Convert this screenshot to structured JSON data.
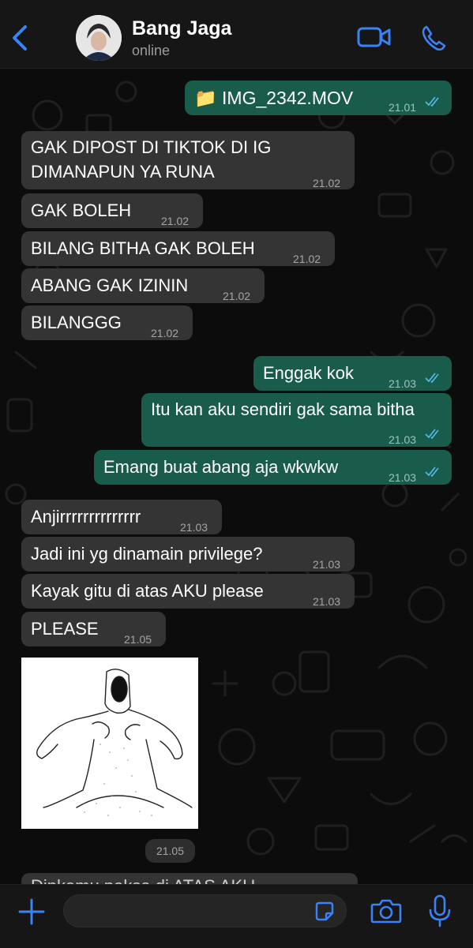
{
  "header": {
    "contact_name": "Bang Jaga",
    "status": "online"
  },
  "messages": [
    {
      "dir": "out",
      "text": "📁 IMG_2342.MOV",
      "time": "21.01",
      "read": true
    },
    {
      "dir": "in",
      "lines": [
        "GAK DIPOST DI TIKTOK DI IG",
        "DIMANAPUN YA RUNA"
      ],
      "time": "21.02"
    },
    {
      "dir": "in",
      "text": "GAK BOLEH",
      "time": "21.02"
    },
    {
      "dir": "in",
      "text": "BILANG BITHA GAK BOLEH",
      "time": "21.02"
    },
    {
      "dir": "in",
      "text": "ABANG GAK IZININ",
      "time": "21.02"
    },
    {
      "dir": "in",
      "text": "BILANGGG",
      "time": "21.02"
    },
    {
      "dir": "out",
      "text": "Enggak kok",
      "time": "21.03",
      "read": true
    },
    {
      "dir": "out",
      "text": "Itu kan aku sendiri gak sama bitha",
      "time": "21.03",
      "read": true
    },
    {
      "dir": "out",
      "text": "Emang buat abang aja wkwkw",
      "time": "21.03",
      "read": true
    },
    {
      "dir": "in",
      "text": "Anjirrrrrrrrrrrrrr",
      "time": "21.03"
    },
    {
      "dir": "in",
      "text": "Jadi ini yg dinamain privilege?",
      "time": "21.03"
    },
    {
      "dir": "in",
      "text": "Kayak gitu di atas AKU please",
      "time": "21.03"
    },
    {
      "dir": "in",
      "text": "PLEASE",
      "time": "21.05"
    }
  ],
  "image_message": {
    "time": "21.05"
  },
  "partial_message": {
    "text": "Dipkamu paksa di ATAS AKU"
  },
  "colors": {
    "outgoing_bubble": "#1a5c4c",
    "incoming_bubble": "#343434",
    "accent": "#3b82f6",
    "read_ticks": "#53bdeb"
  }
}
